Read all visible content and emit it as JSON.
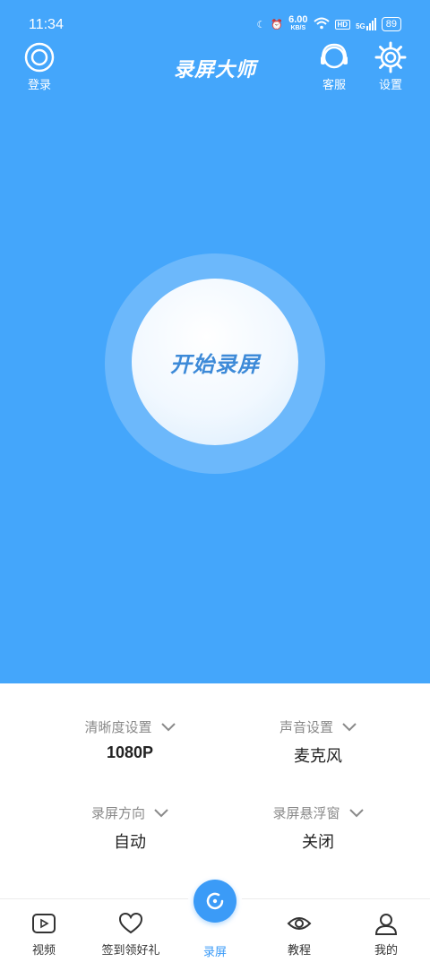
{
  "status_bar": {
    "time": "11:34",
    "speed_value": "6.00",
    "speed_unit": "KB/S",
    "hd": "HD",
    "network": "5G",
    "battery": "89"
  },
  "header": {
    "title": "录屏大师",
    "login_label": "登录",
    "service_label": "客服",
    "settings_label": "设置"
  },
  "main": {
    "record_button_label": "开始录屏"
  },
  "settings": [
    {
      "label": "清晰度设置",
      "value": "1080P"
    },
    {
      "label": "声音设置",
      "value": "麦克风"
    },
    {
      "label": "录屏方向",
      "value": "自动"
    },
    {
      "label": "录屏悬浮窗",
      "value": "关闭"
    }
  ],
  "nav": [
    {
      "label": "视频",
      "icon": "video-icon"
    },
    {
      "label": "签到领好礼",
      "icon": "heart-icon"
    },
    {
      "label": "录屏",
      "icon": "record-icon"
    },
    {
      "label": "教程",
      "icon": "eye-icon"
    },
    {
      "label": "我的",
      "icon": "user-icon"
    }
  ],
  "colors": {
    "primary": "#44a6fb",
    "accent": "#3b9bf7",
    "ring": "#6cb8fb"
  }
}
